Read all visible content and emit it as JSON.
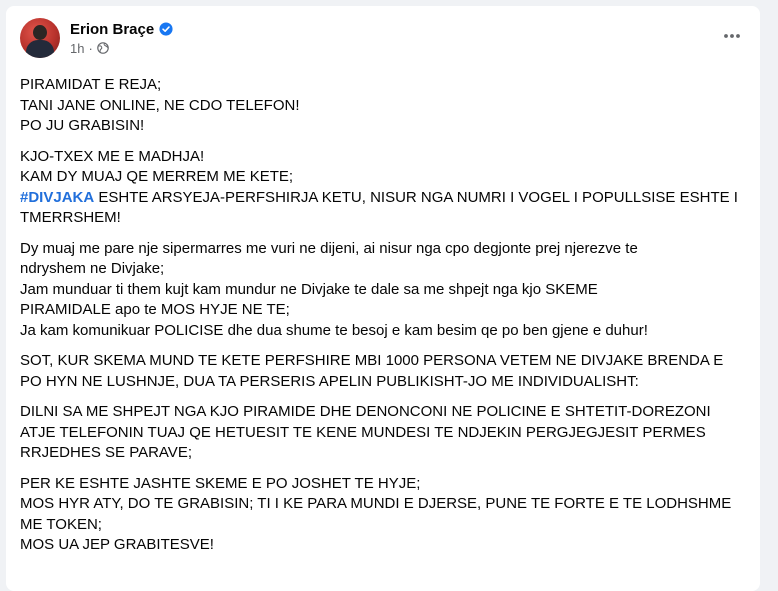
{
  "post": {
    "author_name": "Erion Braçe",
    "time": "1h",
    "time_separator": "·",
    "icons": {
      "verified": "verified-badge-icon",
      "audience": "globe-icon",
      "more": "more-options-icon"
    },
    "colors": {
      "verified": "#1877f2",
      "hashtag": "#216fdb",
      "text": "#050505",
      "muted": "#65676b"
    },
    "paragraphs": [
      {
        "lines": [
          "PIRAMIDAT E REJA;",
          "TANI JANE ONLINE, NE CDO TELEFON!",
          "PO JU GRABISIN!"
        ]
      },
      {
        "lines": [
          "KJO-TXEX ME E MADHJA!",
          "KAM DY MUAJ QE MERREM ME KETE;"
        ],
        "hashtag": "#DIVJAKA",
        "hashtag_rest": [
          " ESHTE ARSYEJA-PERFSHIRJA KETU, NISUR NGA NUMRI I VOGEL I POPULLSISE ESHTE I",
          "TMERRSHEM!"
        ]
      },
      {
        "lines": [
          "Dy muaj me pare nje sipermarres me vuri ne dijeni, ai nisur nga cpo degjonte prej njerezve te",
          "ndryshem ne Divjake;",
          "Jam munduar ti them kujt kam mundur ne Divjake te dale sa me shpejt nga kjo SKEME",
          "PIRAMIDALE apo te MOS HYJE NE TE;",
          "Ja kam komunikuar POLICISE dhe dua shume te besoj e kam besim qe po ben gjene e duhur!"
        ]
      },
      {
        "lines": [
          "SOT, KUR SKEMA MUND TE KETE PERFSHIRE MBI 1000 PERSONA VETEM NE DIVJAKE BRENDA E",
          "PO HYN NE LUSHNJE, DUA TA PERSERIS APELIN PUBLIKISHT-JO ME INDIVIDUALISHT:"
        ]
      },
      {
        "lines": [
          "DILNI SA ME SHPEJT NGA KJO PIRAMIDE DHE DENONCONI NE POLICINE E SHTETIT-DOREZONI",
          "ATJE TELEFONIN TUAJ QE HETUESIT TE KENE MUNDESI TE NDJEKIN PERGJEGJESIT PERMES",
          "RRJEDHES SE PARAVE;"
        ]
      },
      {
        "lines": [
          "PER KE ESHTE JASHTE SKEME E PO JOSHET TE HYJE;",
          "MOS HYR ATY, DO TE GRABISIN; TI I KE PARA MUNDI E DJERSE, PUNE TE FORTE E TE LODHSHME",
          "ME TOKEN;",
          "MOS UA JEP GRABITESVE!"
        ]
      }
    ]
  }
}
